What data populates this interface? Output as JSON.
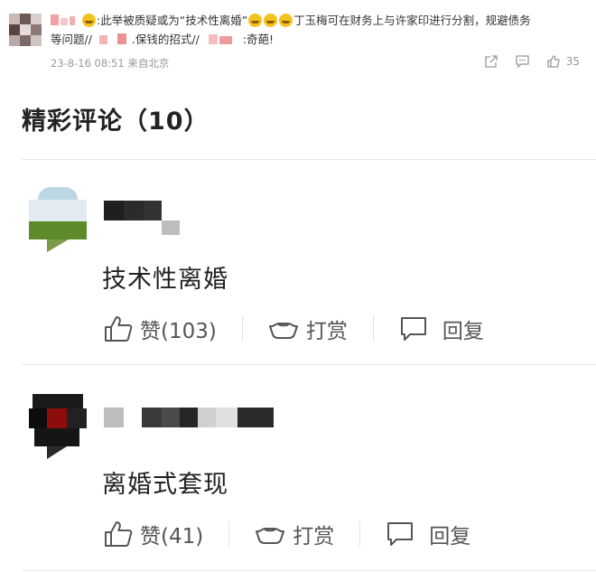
{
  "top_post": {
    "text_a": ":此举被质疑或为",
    "quote": "“技术性离婚”",
    "text_b": "丁玉梅可在财务上与许家印进行分割，规避债务",
    "line2_a": "等问题//",
    "line2_b": ".保钱的招式//",
    "line2_c": ":奇葩!",
    "time": "23-8-16 08:51",
    "source": "来自北京",
    "like_count": "35"
  },
  "section": {
    "title": "精彩评论（10）"
  },
  "comments": [
    {
      "content": "技术性离婚",
      "like_label": "赞(103)",
      "tip_label": "打赏",
      "reply_label": "回复"
    },
    {
      "content": "离婚式套现",
      "like_label": "赞(41)",
      "tip_label": "打赏",
      "reply_label": "回复"
    }
  ],
  "colors": {
    "text": "#222222",
    "meta": "#999999",
    "divider": "#e8e8e8",
    "emoji": "#f2c31c"
  }
}
